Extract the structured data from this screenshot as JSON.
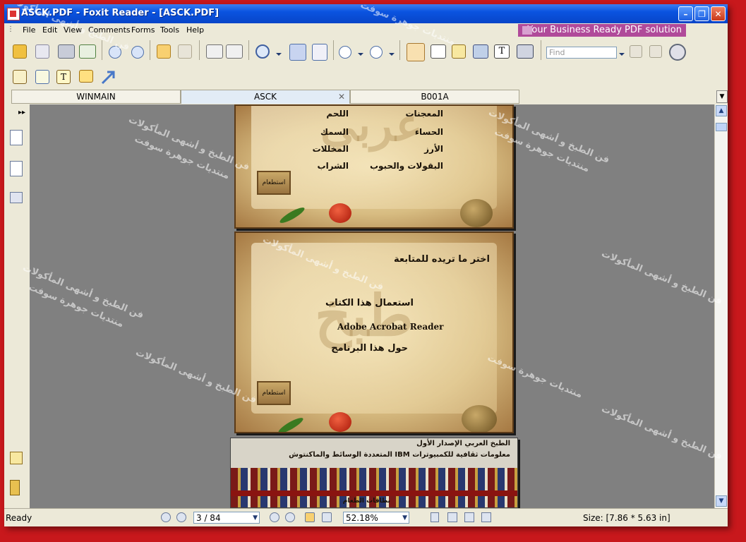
{
  "window": {
    "title": "ASCK.PDF - Foxit Reader - [ASCK.PDF]"
  },
  "menu": [
    "File",
    "Edit",
    "View",
    "Comments",
    "Forms",
    "Tools",
    "Help"
  ],
  "promo": {
    "label": "Your Business Ready PDF solution"
  },
  "search": {
    "placeholder": "Find"
  },
  "tabs": [
    {
      "label": "WINMAIN",
      "active": false
    },
    {
      "label": "ASCK",
      "active": true
    },
    {
      "label": "B001A",
      "active": false
    }
  ],
  "pages": {
    "p1": {
      "items_right": [
        "المعجنات",
        "الحساء",
        "الأرز",
        "البقولات والحبوب"
      ],
      "items_left": [
        "اللحم",
        "السمك",
        "المخللات",
        "الشراب"
      ],
      "back_label": "استطعام"
    },
    "p2": {
      "heading": "اختر ما تريده للمتابعة",
      "options": [
        "استعمال هذا الكتاب",
        "Adobe Acrobat Reader",
        "حول هذا البرنامج"
      ],
      "back_label": "استطعام"
    },
    "p3": {
      "line1": "الطبخ العربي الإصدار الأول",
      "line2": "معلومات ثقافية للكمبيوترات IBM المتعددة الوسائط والماكنتوش",
      "footer": "بطاقات الطعام"
    }
  },
  "status": {
    "left": "Ready",
    "page": "3 / 84",
    "zoom": "52.18%",
    "size": "Size: [7.86 * 5.63 in]"
  },
  "watermark": {
    "line1": "فن الطبخ و أشهى المأكولات",
    "line2": "منتديات جوهرة سوفت"
  }
}
